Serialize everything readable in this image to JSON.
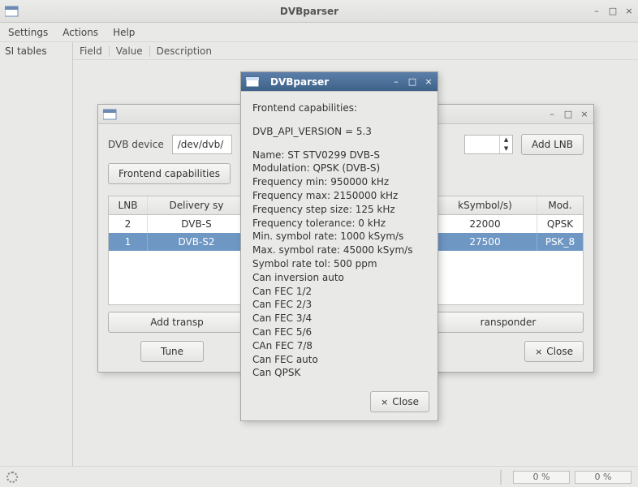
{
  "main_window": {
    "title": "DVBparser",
    "menu": [
      "Settings",
      "Actions",
      "Help"
    ],
    "sidebar_header": "SI tables",
    "columns": [
      "Field",
      "Value",
      "Description"
    ],
    "progress1": "0 %",
    "progress2": "0 %"
  },
  "device_dialog": {
    "device_label": "DVB device",
    "device_value": "/dev/dvb/",
    "add_lnb": "Add LNB",
    "frontend_caps": "Frontend capabilities",
    "lnb_table": {
      "headers": [
        "LNB",
        "Delivery sy"
      ],
      "rows": [
        {
          "lnb": "2",
          "sys": "DVB-S"
        },
        {
          "lnb": "1",
          "sys": "DVB-S2"
        }
      ]
    },
    "right_table": {
      "headers": [
        "kSymbol/s)",
        "Mod."
      ],
      "rows": [
        {
          "ks": "22000",
          "mod": "QPSK"
        },
        {
          "ks": "27500",
          "mod": "PSK_8"
        }
      ]
    },
    "add_transp_left": "Add transp",
    "add_transp_right": "ransponder",
    "tune": "Tune",
    "close": "Close"
  },
  "caps_dialog": {
    "title": "DVBparser",
    "heading": "Frontend capabilities:",
    "api": "DVB_API_VERSION = 5.3",
    "lines": [
      "Name:   ST STV0299 DVB-S",
      "Modulation:   QPSK (DVB-S)",
      "Frequency min:   950000 kHz",
      "Frequency max:   2150000 kHz",
      "Frequency step size:   125 kHz",
      "Frequency tolerance:   0 kHz",
      "Min. symbol rate:   1000 kSym/s",
      "Max. symbol rate:   45000 kSym/s",
      "Symbol rate tol:   500 ppm",
      "Can inversion auto",
      "Can FEC 1/2",
      "Can FEC 2/3",
      "Can FEC 3/4",
      "Can FEC 5/6",
      "CAn FEC 7/8",
      "Can FEC auto",
      "Can QPSK"
    ],
    "close": "Close"
  }
}
